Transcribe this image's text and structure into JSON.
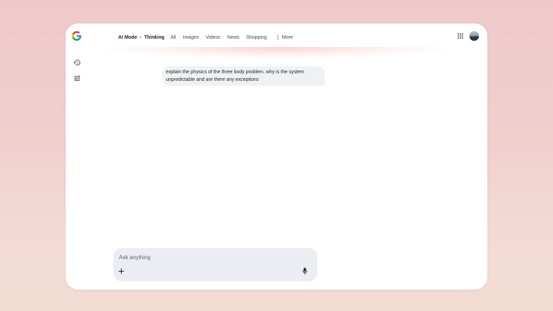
{
  "header": {
    "breadcrumb": {
      "mode": "AI Mode",
      "separator": "›",
      "model": "Thinking"
    },
    "tabs": [
      {
        "label": "All"
      },
      {
        "label": "Images"
      },
      {
        "label": "Videos"
      },
      {
        "label": "News"
      },
      {
        "label": "Shopping"
      }
    ],
    "more_label": "More",
    "more_icon": "more-vert-icon",
    "apps_icon": "apps-grid-icon",
    "avatar_icon": "account-avatar"
  },
  "sidebar": {
    "icons": [
      "history-icon",
      "new-chat-icon"
    ]
  },
  "conversation": {
    "user_prompt": "explain the physics of the three body problem. why is the system unpredictable and are there any exceptions"
  },
  "composer": {
    "placeholder": "Ask anything",
    "add_icon": "plus-icon",
    "mic_icon": "microphone-icon"
  },
  "colors": {
    "page_background": "#eec9cb",
    "panel": "#ffffff",
    "prompt_bubble": "#f0f1f4",
    "composer": "#ecedf2",
    "google_blue": "#4285f4",
    "google_red": "#ea4335",
    "google_yellow": "#fbbc05",
    "google_green": "#34a853"
  }
}
